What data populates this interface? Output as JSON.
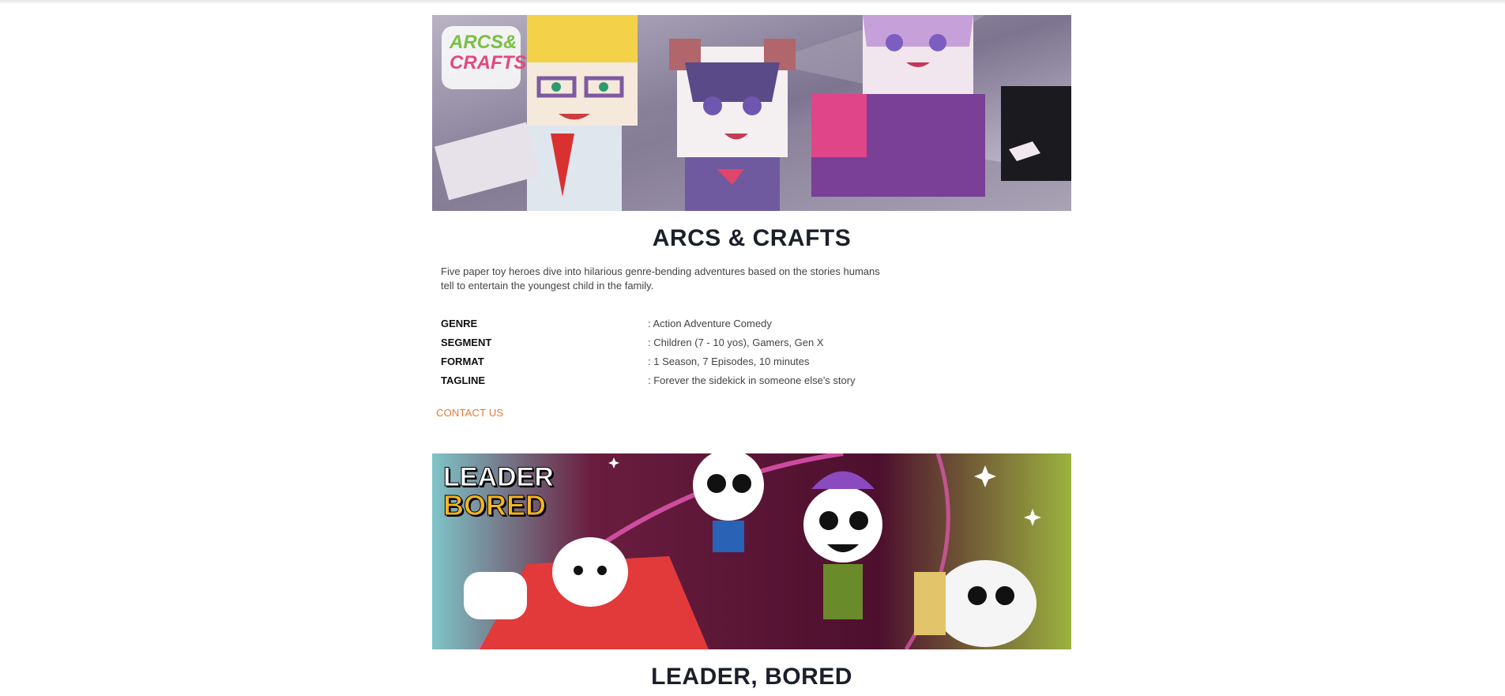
{
  "shows": [
    {
      "logo_text_line1": "ARCS&",
      "logo_text_line2": "CRAFTS",
      "title": "ARCS & CRAFTS",
      "description": "Five paper toy heroes dive into hilarious genre-bending adventures based on the stories humans tell to entertain the youngest child in the family.",
      "meta": [
        {
          "key": "GENRE",
          "value": ": Action Adventure Comedy"
        },
        {
          "key": "SEGMENT",
          "value": ": Children (7 - 10 yos), Gamers, Gen X"
        },
        {
          "key": "FORMAT",
          "value": ": 1 Season, 7 Episodes, 10 minutes"
        },
        {
          "key": "TAGLINE",
          "value": ": Forever the sidekick in someone else's story"
        }
      ],
      "contact_label": "CONTACT US"
    },
    {
      "logo_text_line1": "LEADER",
      "logo_text_line2": "BORED",
      "title": "LEADER, BORED"
    }
  ],
  "colors": {
    "accent": "#e8773a",
    "title": "#1b1f2a"
  }
}
